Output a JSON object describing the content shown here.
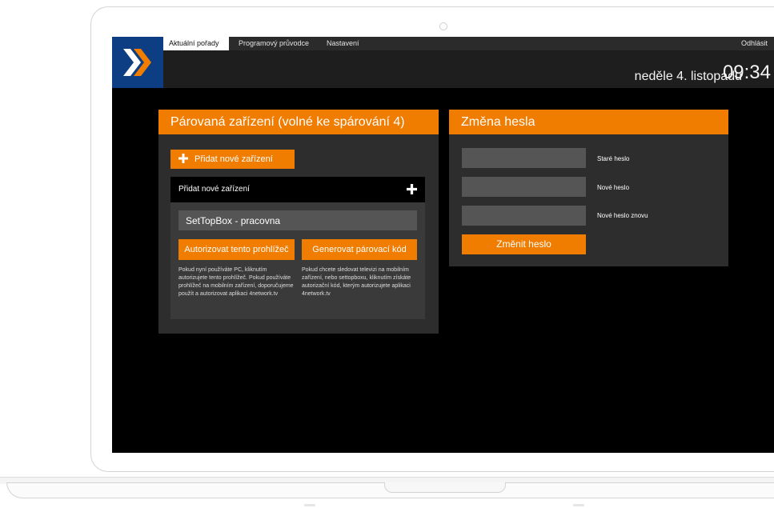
{
  "nav": {
    "tabs": [
      {
        "label": "Aktuální pořady",
        "active": true
      },
      {
        "label": "Programový průvodce",
        "active": false
      },
      {
        "label": "Nastavení",
        "active": false
      }
    ],
    "logout": "Odhlásit"
  },
  "header": {
    "date": "neděle 4. listopadu",
    "time": "09:34"
  },
  "paired": {
    "title": "Párovaná zařízení (volné ke spárování 4)",
    "add_button": "Přidat nové zařízení",
    "add_section_title": "Přidat nové zařízení",
    "device_name_value": "SetTopBox - pracovna",
    "authorize_button": "Autorizovat tento prohlížeč",
    "generate_button": "Generovat párovací kód",
    "authorize_help": "Pokud nyní používáte PC, kliknutím autorizujete tento prohlížeč. Pokud používáte prohlížeč na mobilním zařízení, doporučujeme použít a autorizovat aplikaci 4network.tv",
    "generate_help": "Pokud chcete sledovat televizi na mobilním zařízení, nebo settopboxu, kliknutím získáte autorizační kód, kterým autorizujete aplikaci 4network.tv"
  },
  "password": {
    "title": "Změna hesla",
    "old_label": "Staré heslo",
    "new_label": "Nové heslo",
    "repeat_label": "Nové heslo znovu",
    "submit_button": "Změnit heslo"
  },
  "colors": {
    "accent": "#f07c00",
    "logo_bg": "#0d3d83",
    "panel_bg": "#2d2d2d"
  }
}
